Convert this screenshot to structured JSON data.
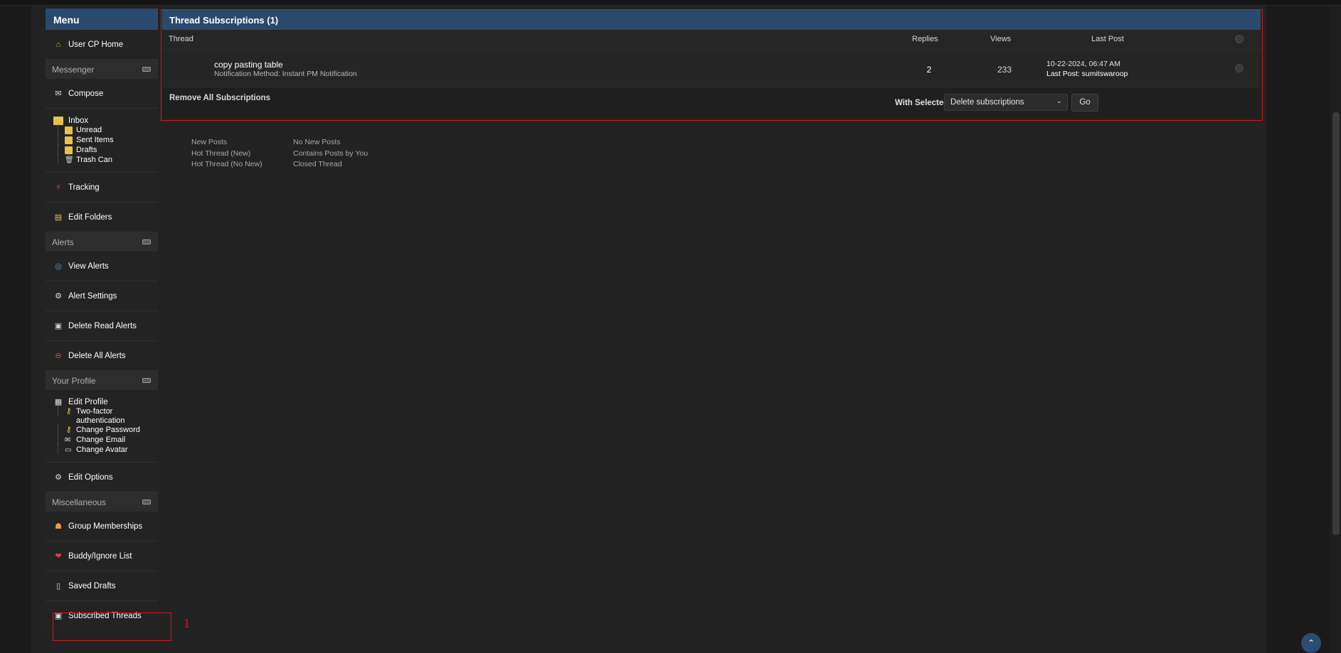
{
  "sidebar": {
    "menu_title": "Menu",
    "user_cp_home": "User CP Home",
    "messenger": {
      "heading": "Messenger",
      "compose": "Compose",
      "inbox": "Inbox",
      "subfolders": [
        "Unread",
        "Sent Items",
        "Drafts",
        "Trash Can"
      ],
      "tracking": "Tracking",
      "edit_folders": "Edit Folders"
    },
    "alerts": {
      "heading": "Alerts",
      "items": [
        "View Alerts",
        "Alert Settings",
        "Delete Read Alerts",
        "Delete All Alerts"
      ]
    },
    "profile": {
      "heading": "Your Profile",
      "edit_profile": "Edit Profile",
      "subitems": [
        "Two-factor authentication",
        "Change Password",
        "Change Email",
        "Change Avatar"
      ],
      "edit_options": "Edit Options"
    },
    "misc": {
      "heading": "Miscellaneous",
      "items": [
        "Group Memberships",
        "Buddy/Ignore List",
        "Saved Drafts",
        "Subscribed Threads"
      ]
    }
  },
  "subscriptions": {
    "title": "Thread Subscriptions (1)",
    "columns": {
      "thread": "Thread",
      "replies": "Replies",
      "views": "Views",
      "last_post": "Last Post"
    },
    "rows": [
      {
        "title": "copy pasting table",
        "notification": "Notification Method: Instant PM Notification",
        "replies": "2",
        "views": "233",
        "last_post_date": "10-22-2024, 06:47 AM",
        "last_post_by": "Last Post: sumitswaroop"
      }
    ],
    "remove_all": "Remove All Subscriptions",
    "with_selected": "With Selected:",
    "action_select": "Delete subscriptions",
    "go": "Go"
  },
  "legend": {
    "col1": [
      "New Posts",
      "Hot Thread (New)",
      "Hot Thread (No New)"
    ],
    "col2": [
      "No New Posts",
      "Contains Posts by You",
      "Closed Thread"
    ]
  },
  "annotation": {
    "label": "1"
  },
  "colors": {
    "header_blue": "#2a4a6d",
    "annotation_red": "#d11a1a"
  }
}
